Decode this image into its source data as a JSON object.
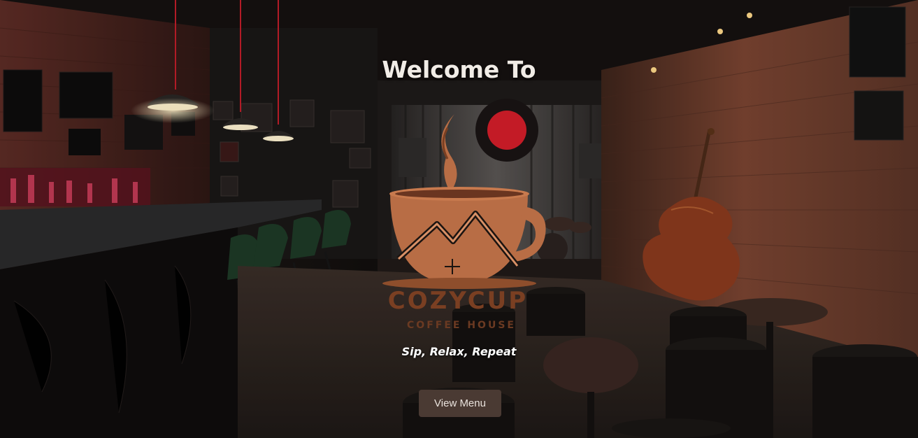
{
  "hero": {
    "heading": "Welcome To",
    "brand_name": "COZYCUP",
    "brand_subtitle": "COFFEE HOUSE",
    "tagline": "Sip, Relax, Repeat",
    "menu_button_label": "View Menu"
  },
  "colors": {
    "logo_copper": "#b86d45",
    "logo_dark": "#7a3f22",
    "button_bg": "#4a3a33",
    "brick_wall": "#6b3a2c",
    "stage_red": "#d41e2a"
  },
  "icons": {
    "logo": "coffee-cup-steam-house-icon",
    "double_bass": "double-bass-icon",
    "pendant_lamp": "pendant-lamp-icon"
  }
}
